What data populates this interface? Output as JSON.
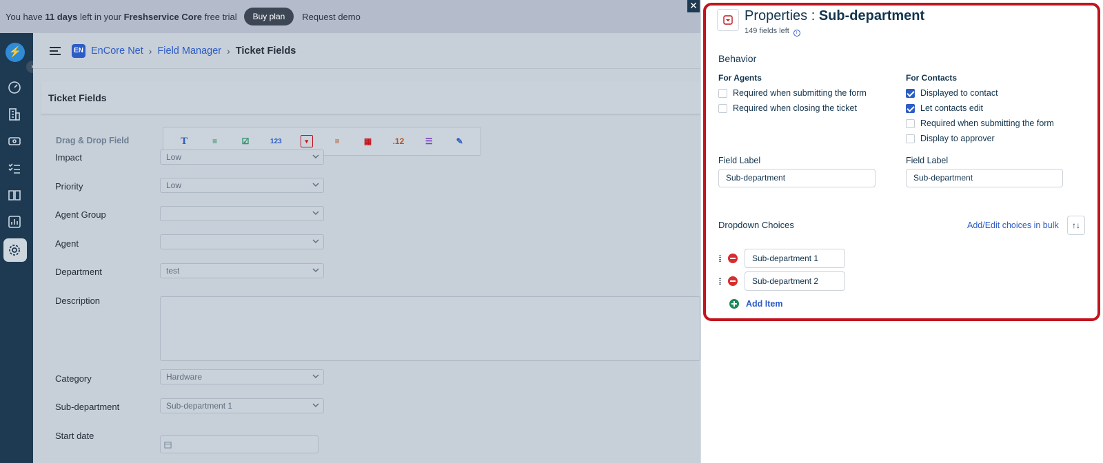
{
  "trial_bar": {
    "pre": "You have ",
    "days": "11 days",
    "mid": " left in your ",
    "product": "Freshservice Core",
    "post": " free trial",
    "buy_label": "Buy plan",
    "demo_label": "Request demo"
  },
  "breadcrumb": {
    "workspace_badge": "EN",
    "workspace": "EnCore Net",
    "sep": "›",
    "section": "Field Manager",
    "current": "Ticket Fields"
  },
  "page": {
    "section_title": "Ticket Fields",
    "dnd_label": "Drag & Drop Field"
  },
  "toolbar": {
    "tools": [
      "T",
      "≡",
      "☑",
      "123",
      "▾",
      "≡",
      "▦",
      ".12",
      "☰",
      "✎"
    ]
  },
  "form": {
    "fields": [
      {
        "label": "Impact",
        "value": "Low"
      },
      {
        "label": "Priority",
        "value": "Low"
      },
      {
        "label": "Agent Group",
        "value": ""
      },
      {
        "label": "Agent",
        "value": ""
      },
      {
        "label": "Department",
        "value": "test"
      },
      {
        "label": "Description",
        "value": ""
      },
      {
        "label": "Category",
        "value": "Hardware"
      },
      {
        "label": "Sub-department",
        "value": "Sub-department 1"
      },
      {
        "label": "Start date",
        "value": ""
      }
    ]
  },
  "panel": {
    "title_prefix": "Properties : ",
    "title_field": "Sub-department",
    "fields_left": "149 fields left",
    "behavior": "Behavior",
    "agents_head": "For Agents",
    "contacts_head": "For Contacts",
    "agents": [
      {
        "label": "Required when submitting the form",
        "checked": false
      },
      {
        "label": "Required when closing the ticket",
        "checked": false
      }
    ],
    "contacts": [
      {
        "label": "Displayed to contact",
        "checked": true
      },
      {
        "label": "Let contacts edit",
        "checked": true
      },
      {
        "label": "Required when submitting the form",
        "checked": false
      },
      {
        "label": "Display to approver",
        "checked": false
      }
    ],
    "field_label_agents": "Field Label",
    "field_label_agents_value": "Sub-department",
    "field_label_contacts": "Field Label",
    "field_label_contacts_value": "Sub-department",
    "dropdown_choices": "Dropdown Choices",
    "bulk_link": "Add/Edit choices in bulk",
    "sort_icon": "↑↓",
    "choices": [
      "Sub-department 1",
      "Sub-department 2"
    ],
    "add_item": "Add Item"
  },
  "colors": {
    "accent": "#2c5cc5",
    "highlight_frame": "#c2141d",
    "sidebar": "#1d3a52",
    "remove": "#d72d30",
    "add": "#1b8a5a"
  }
}
